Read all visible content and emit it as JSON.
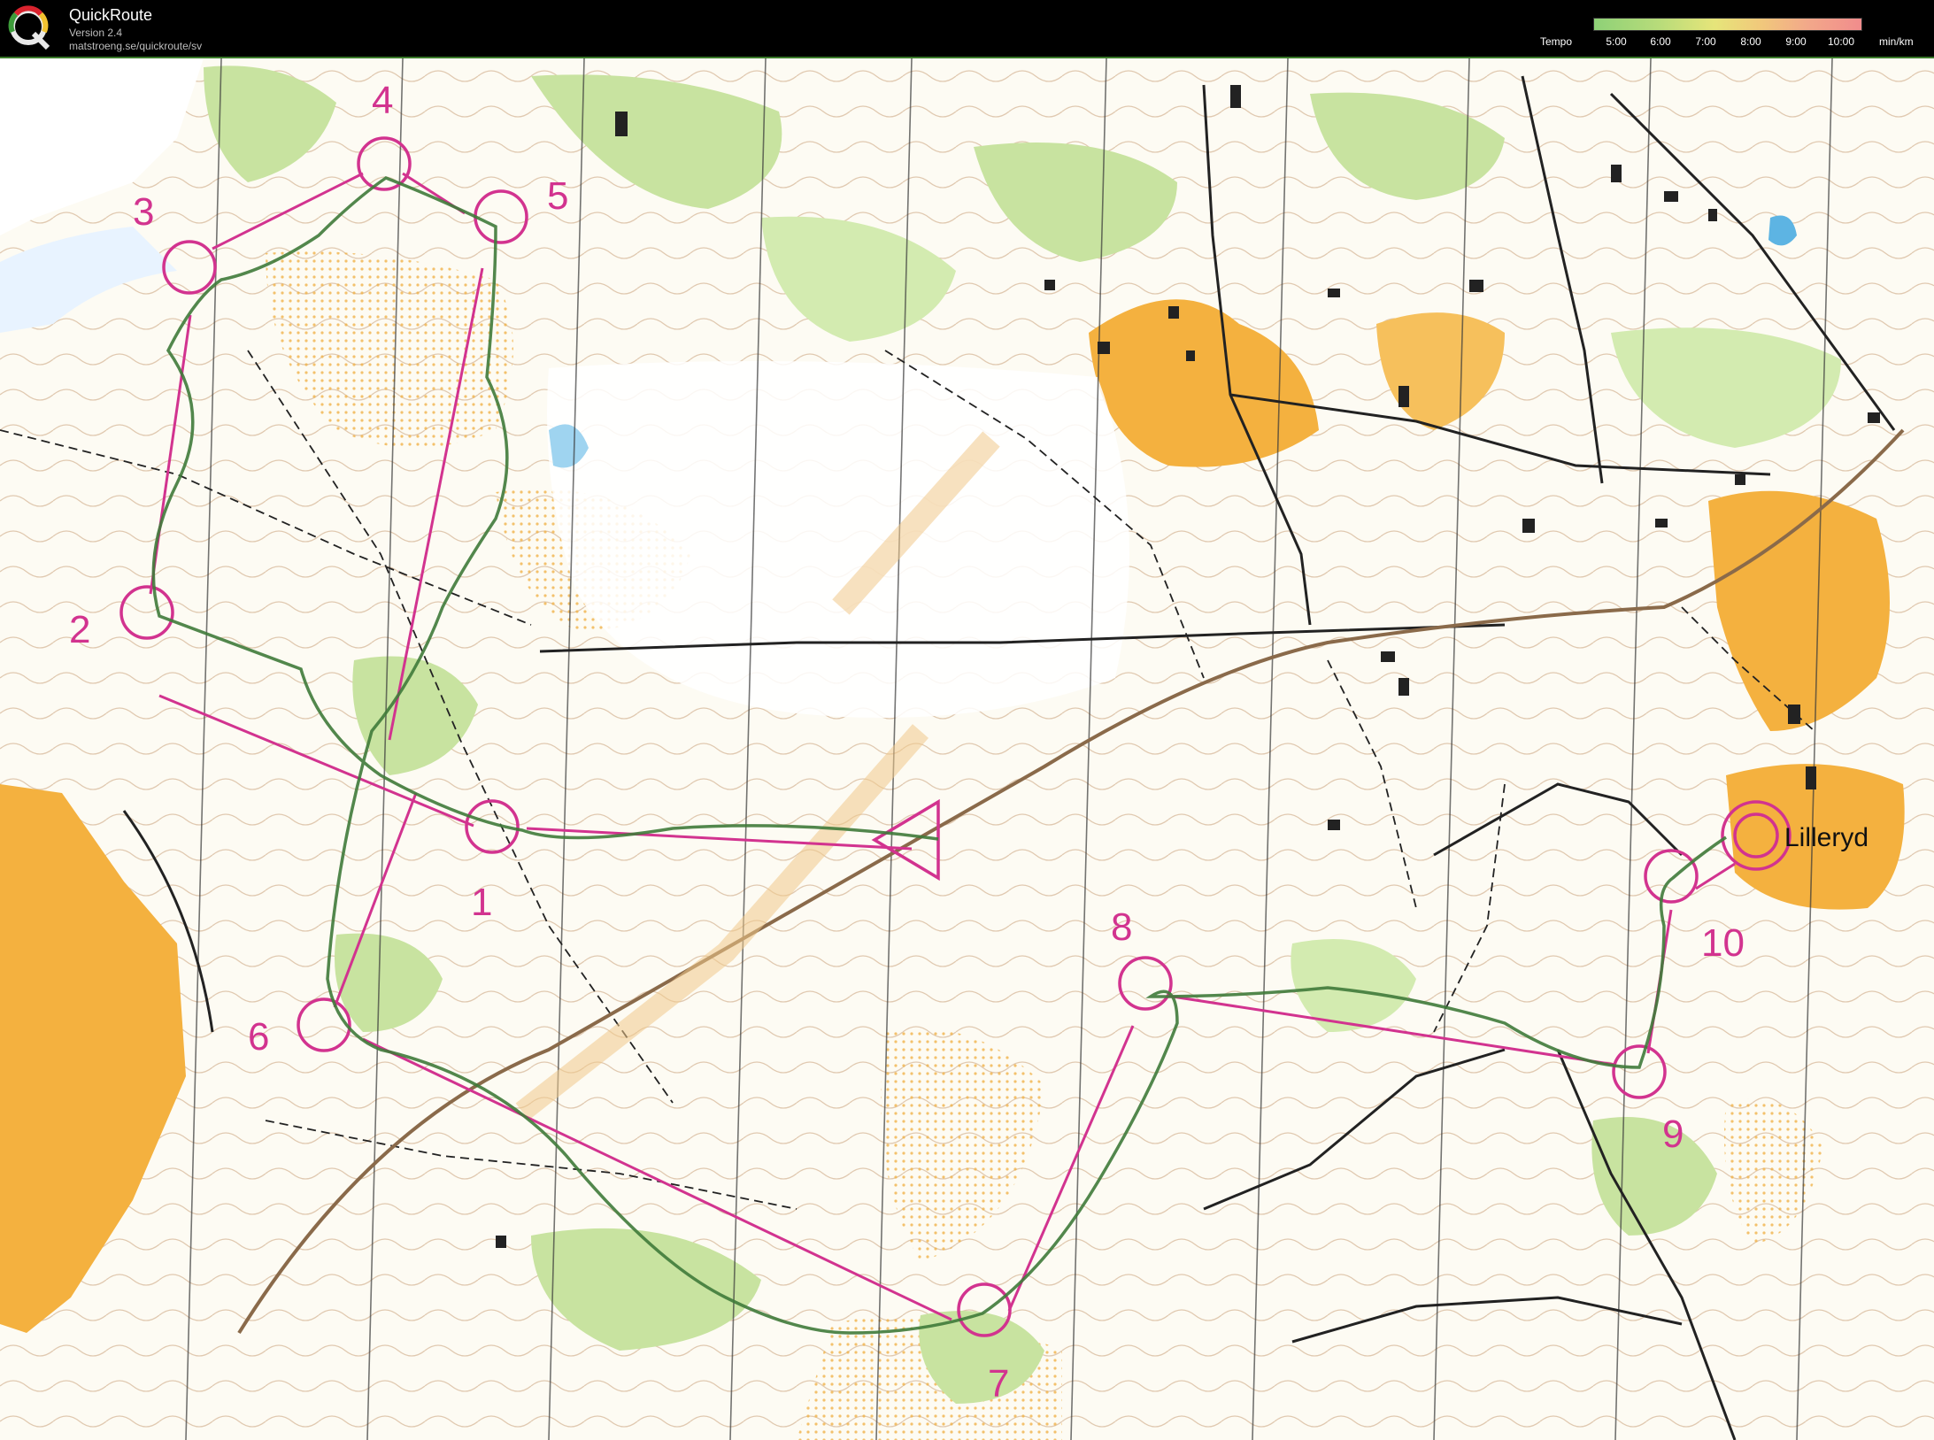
{
  "header": {
    "app_name": "QuickRoute",
    "version": "Version 2.4",
    "url": "matstroeng.se/quickroute/sv",
    "tempo_label": "Tempo",
    "tempo_ticks": [
      "5:00",
      "6:00",
      "7:00",
      "8:00",
      "9:00",
      "10:00"
    ],
    "tempo_unit": "min/km"
  },
  "map": {
    "place_name": "Lilleryd",
    "controls": [
      {
        "label": "1"
      },
      {
        "label": "2"
      },
      {
        "label": "3"
      },
      {
        "label": "4"
      },
      {
        "label": "5"
      },
      {
        "label": "6"
      },
      {
        "label": "7"
      },
      {
        "label": "8"
      },
      {
        "label": "9"
      },
      {
        "label": "10"
      }
    ],
    "colors": {
      "course": "#d2338f",
      "route": "#3f7a3a",
      "open_land": "#f4b13f",
      "forest_green": "#c8e3a0",
      "paper": "#fdfbf3"
    }
  }
}
